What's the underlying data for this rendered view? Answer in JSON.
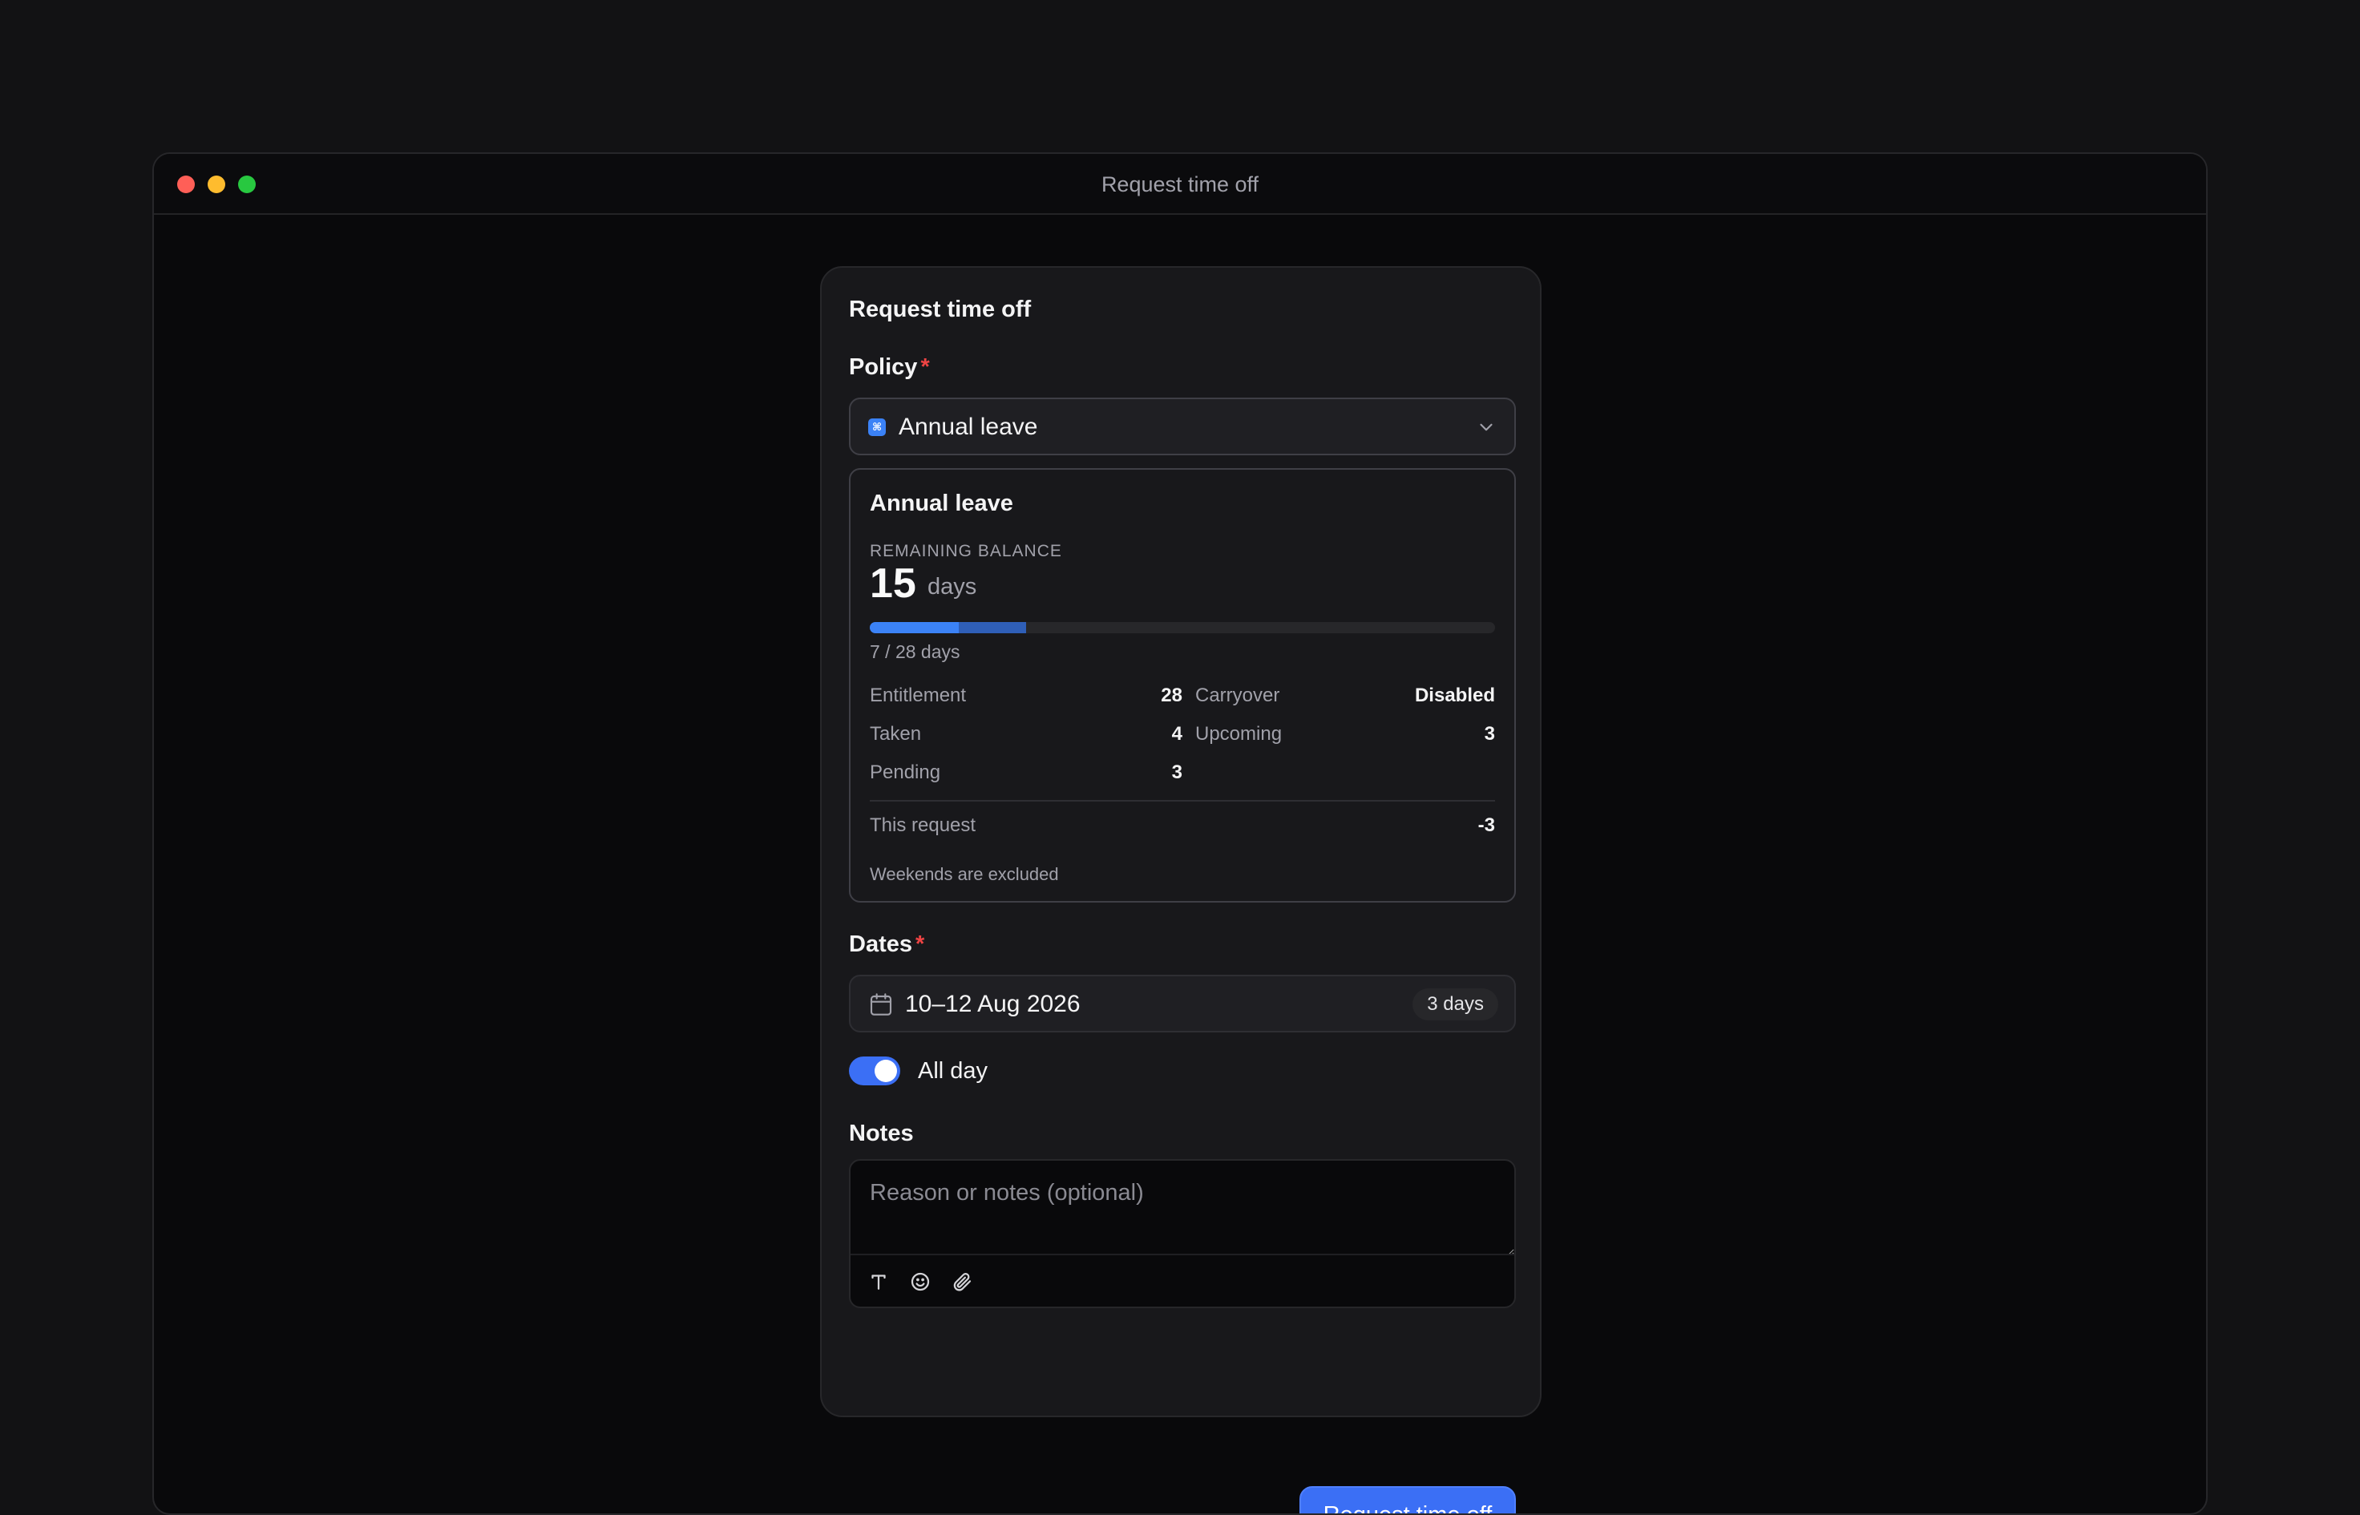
{
  "window": {
    "title": "Request time off"
  },
  "form": {
    "title": "Request time off",
    "policy_label": "Policy",
    "required_mark": "*",
    "policy_value": "Annual leave",
    "policy_badge": "⌘",
    "dates_label": "Dates",
    "dates_value": "10–12 Aug 2026",
    "dates_count": "3 days",
    "all_day_label": "All day",
    "all_day_on": true,
    "notes_label": "Notes",
    "notes_placeholder": "Reason or notes (optional)",
    "notes_value": "",
    "submit_label": "Request time off"
  },
  "balance": {
    "title": "Annual leave",
    "caption": "REMAINING BALANCE",
    "remaining": "15",
    "remaining_unit": "days",
    "used_text": "7 / 28 days",
    "progress": {
      "taken": 4,
      "pending": 3,
      "total": 28
    },
    "stats": {
      "entitlement_label": "Entitlement",
      "entitlement_value": "28",
      "carryover_label": "Carryover",
      "carryover_value": "Disabled",
      "taken_label": "Taken",
      "taken_value": "4",
      "upcoming_label": "Upcoming",
      "upcoming_value": "3",
      "pending_label": "Pending",
      "pending_value": "3"
    },
    "this_request_label": "This request",
    "this_request_value": "-3",
    "note": "Weekends are excluded"
  },
  "colors": {
    "accent": "#3b6ff5",
    "required": "#ef4444",
    "background": "#09090b",
    "card": "#18181b"
  },
  "icons": {
    "policy": "policy-badge-icon",
    "chevron": "chevron-down-icon",
    "calendar": "calendar-icon",
    "text_format": "text-format-icon",
    "emoji": "emoji-icon",
    "attach": "paperclip-icon"
  }
}
